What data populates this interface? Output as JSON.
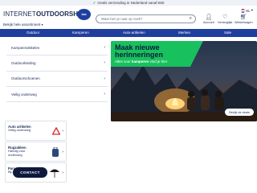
{
  "topbar": {
    "text": "Gratis verzending in Nederland vanaf €50"
  },
  "header": {
    "logo_part1": "INTERNET-",
    "logo_part2": "OUTDOORSHOP",
    "logo_badge": "bas",
    "assortment": "Bekijk hele assortiment",
    "search_placeholder": "Waar ben je naar op zoek?",
    "account_label": "Account",
    "wishlist_label": "Verlanglijst",
    "cart_label": "Winkelwagen",
    "language": "NL"
  },
  "nav": {
    "items": [
      "Outdoor",
      "Kamperen",
      "Auto-artikelen",
      "Merken",
      "Sale"
    ]
  },
  "categories": [
    "Kampeerartikelen",
    "Outdoorkleding",
    "Outdoorschoenen",
    "Veilig onderweg"
  ],
  "cards": [
    {
      "title": "Auto artikelen",
      "subtitle": "Veilig onderweg"
    },
    {
      "title": "Rugzakken",
      "subtitle": "Handig voor onderweg"
    },
    {
      "title": "Parasols",
      "subtitle": "Bij zon of regen"
    }
  ],
  "contact_button": "CONTACT",
  "banner": {
    "title_line1": "Maak nieuwe",
    "title_line2": "herinneringen",
    "sub_pre": "Alles voor ",
    "sub_bold": "kamperen",
    "sub_post": " vind je hier",
    "cta": "Bekijk de deals"
  },
  "colors": {
    "brand_blue": "#1f3f9e",
    "banner_green": "#18c15e",
    "navy": "#0e1a3d"
  }
}
